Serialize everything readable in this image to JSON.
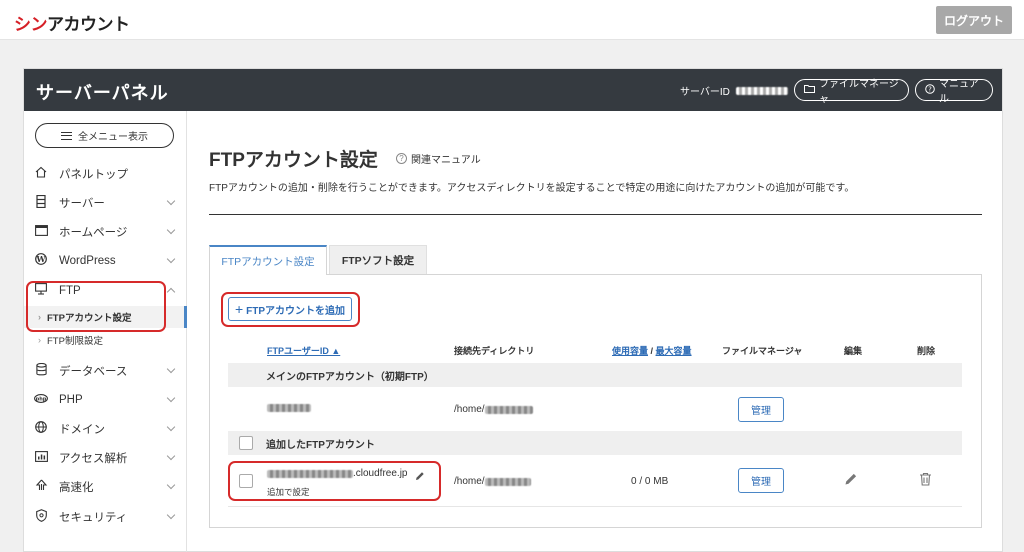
{
  "brand": {
    "logo_red": "シン",
    "logo_dark": "アカウント"
  },
  "topbar": {
    "logout_label": "ログアウト"
  },
  "panel": {
    "title": "サーバーパネル",
    "server_id_label": "サーバーID",
    "file_manager_label": "ファイルマネージャ",
    "manual_label": "マニュアル"
  },
  "sidebar": {
    "all_menu_label": "全メニュー表示",
    "items": [
      {
        "label": "パネルトップ",
        "icon": "home-icon"
      },
      {
        "label": "サーバー",
        "icon": "server-icon"
      },
      {
        "label": "ホームページ",
        "icon": "browser-icon"
      },
      {
        "label": "WordPress",
        "icon": "wordpress-icon"
      },
      {
        "label": "FTP",
        "icon": "monitor-icon"
      },
      {
        "label": "データベース",
        "icon": "database-icon"
      },
      {
        "label": "PHP",
        "icon": "php-icon"
      },
      {
        "label": "ドメイン",
        "icon": "globe-icon"
      },
      {
        "label": "アクセス解析",
        "icon": "chart-icon"
      },
      {
        "label": "高速化",
        "icon": "speed-icon"
      },
      {
        "label": "セキュリティ",
        "icon": "shield-icon"
      }
    ],
    "ftp_sub": [
      {
        "label": "FTPアカウント設定"
      },
      {
        "label": "FTP制限設定"
      }
    ]
  },
  "main": {
    "title": "FTPアカウント設定",
    "manual_link": "関連マニュアル",
    "description": "FTPアカウントの追加・削除を行うことができます。アクセスディレクトリを設定することで特定の用途に向けたアカウントの追加が可能です。",
    "tabs": [
      {
        "label": "FTPアカウント設定"
      },
      {
        "label": "FTPソフト設定"
      }
    ],
    "add_button_label": "FTPアカウントを追加",
    "table": {
      "headers": {
        "user_id": "FTPユーザーID ▲",
        "directory": "接続先ディレクトリ",
        "used": "使用容量",
        "sep": " / ",
        "max": "最大容量",
        "file_manager": "ファイルマネージャ",
        "edit": "編集",
        "delete": "削除"
      },
      "group_main": "メインのFTPアカウント（初期FTP）",
      "group_added": "追加したFTPアカウント",
      "main_row": {
        "directory_prefix": "/home/",
        "manage_label": "管理"
      },
      "added_row": {
        "user_suffix": ".cloudfree.jp",
        "note": "追加で設定",
        "directory_prefix": "/home/",
        "capacity": "0 / 0 MB",
        "manage_label": "管理"
      }
    }
  },
  "colors": {
    "brand_red": "#d61f26",
    "header_dark": "#353a40",
    "accent_blue": "#4a86c6",
    "highlight_red": "#d62a2a"
  }
}
